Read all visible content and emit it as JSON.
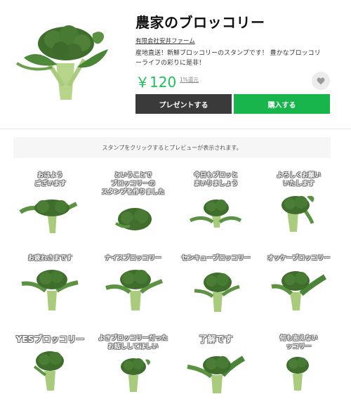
{
  "product": {
    "title": "農家のブロッコリー",
    "author": "有限会社安井ファーム",
    "description": "産地直送！新鮮ブロッコリーのスタンプです！ 豊かなブロッコリーライフの彩りに是非！",
    "price": "￥120",
    "points": "1%還元",
    "fav_icon": "heart-icon"
  },
  "buttons": {
    "gift": "プレゼントする",
    "buy": "購入する"
  },
  "preview_notice": "スタンプをクリックするとプレビューが表示されます。",
  "stickers": [
    {
      "caption_l1": "おはよう",
      "caption_l2": "ございます"
    },
    {
      "caption_l1": "ということで",
      "caption_l2": "ブロッコリーの",
      "caption_l3": "スタンプを作りました"
    },
    {
      "caption_l1": "今日もブロッと",
      "caption_l2": "まいりましょう"
    },
    {
      "caption_l1": "よろしくお願い",
      "caption_l2": "いたします"
    },
    {
      "caption_l1": "お疲れさまです"
    },
    {
      "caption_l1": "ナイスブロッコリー"
    },
    {
      "caption_l1": "センキューブロッコリー"
    },
    {
      "caption_l1": "オッケーブロッコリー"
    },
    {
      "caption_l1": "YESブロッコリー"
    },
    {
      "caption_l1": "よきブロッコリーだった",
      "caption_l2": "お話ししてほしい"
    },
    {
      "caption_l1": "了解です"
    },
    {
      "caption_l1": "何も言えない",
      "caption_l2": "ッコリー"
    }
  ],
  "colors": {
    "accent": "#18b54c",
    "price": "#1dc05a",
    "gift_button": "#3a3a3a"
  }
}
